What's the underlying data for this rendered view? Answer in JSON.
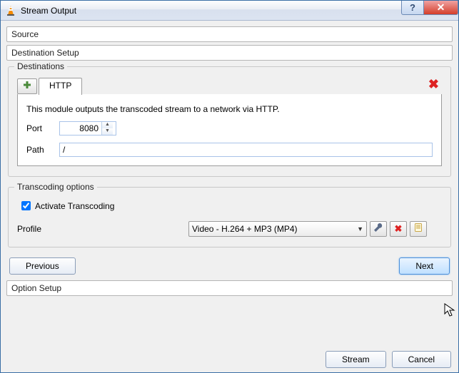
{
  "titlebar": {
    "title": "Stream Output"
  },
  "sections": {
    "source": "Source",
    "dest_setup": "Destination Setup",
    "option_setup": "Option Setup"
  },
  "destinations": {
    "legend": "Destinations",
    "tab_http": "HTTP",
    "description": "This module outputs the transcoded stream to a network via HTTP.",
    "port_label": "Port",
    "port_value": "8080",
    "path_label": "Path",
    "path_value": "/"
  },
  "transcoding": {
    "legend": "Transcoding options",
    "activate": "Activate Transcoding",
    "activate_checked": true,
    "profile_label": "Profile",
    "profile_value": "Video - H.264 + MP3 (MP4)"
  },
  "buttons": {
    "previous": "Previous",
    "next": "Next",
    "stream": "Stream",
    "cancel": "Cancel"
  },
  "icons": {
    "add": "add-icon",
    "remove": "x-icon",
    "edit_profile": "wrench-icon",
    "delete_profile": "x-icon",
    "new_profile": "document-icon"
  }
}
